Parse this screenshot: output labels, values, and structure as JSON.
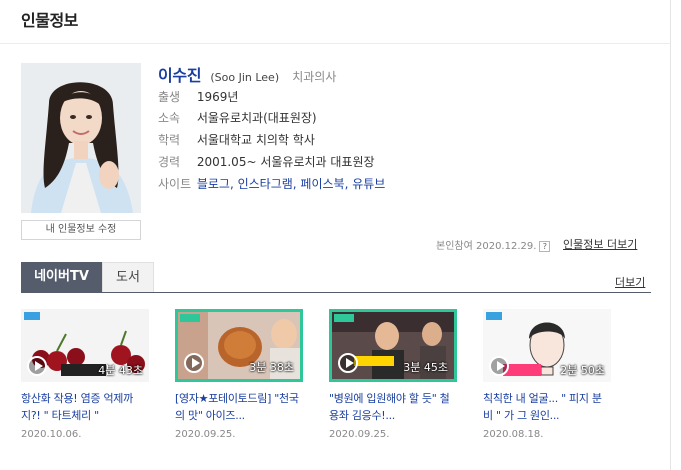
{
  "section": {
    "title": "인물정보"
  },
  "profile": {
    "name": "이수진",
    "english_name": "(Soo Jin Lee)",
    "job": "치과의사",
    "edit_label": "내 인물정보 수정",
    "rows": [
      {
        "key": "출생",
        "value": "1969년"
      },
      {
        "key": "소속",
        "value": "서울유로치과(대표원장)"
      },
      {
        "key": "학력",
        "value": "서울대학교 치의학 학사"
      },
      {
        "key": "경력",
        "value": "2001.05~ 서울유로치과 대표원장"
      },
      {
        "key": "사이트",
        "value": "블로그, 인스타그램, 페이스북, 유튜브"
      }
    ],
    "self_participation": "본인참여 2020.12.29.",
    "help_icon_glyph": "?",
    "more_info_label": "인물정보 더보기"
  },
  "tabs": [
    {
      "label": "네이버TV",
      "active": true
    },
    {
      "label": "도서",
      "active": false
    }
  ],
  "more_label": "더보기",
  "videos": [
    {
      "title": "항산화 작용! 염증 억제까지?! \" 타트체리 \"",
      "date": "2020.10.06.",
      "duration": "4분 43초"
    },
    {
      "title": "[영자★포테이토드림] \"천국의 맛\" 아이즈...",
      "date": "2020.09.25.",
      "duration": "3분 38초"
    },
    {
      "title": "\"병원에 입원해야 할 듯\" 철용좌 김응수!...",
      "date": "2020.09.25.",
      "duration": "3분 45초"
    },
    {
      "title": "칙칙한 내 얼굴... \" 피지 분비 \" 가 그 원인...",
      "date": "2020.08.18.",
      "duration": "2분 50초"
    }
  ],
  "colors": {
    "accent": "#1a3fa0",
    "tab_active": "#555d6d",
    "thumb_border": "#2fc79a"
  }
}
